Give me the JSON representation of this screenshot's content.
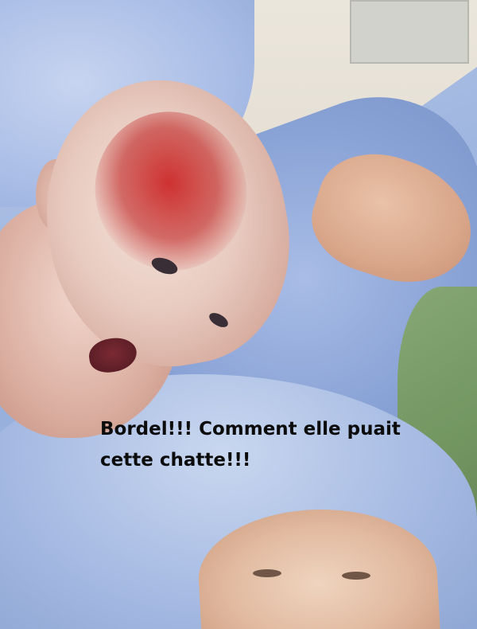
{
  "caption": {
    "line1": "Bordel!!! Comment elle puait",
    "line2": "cette chatte!!!"
  }
}
